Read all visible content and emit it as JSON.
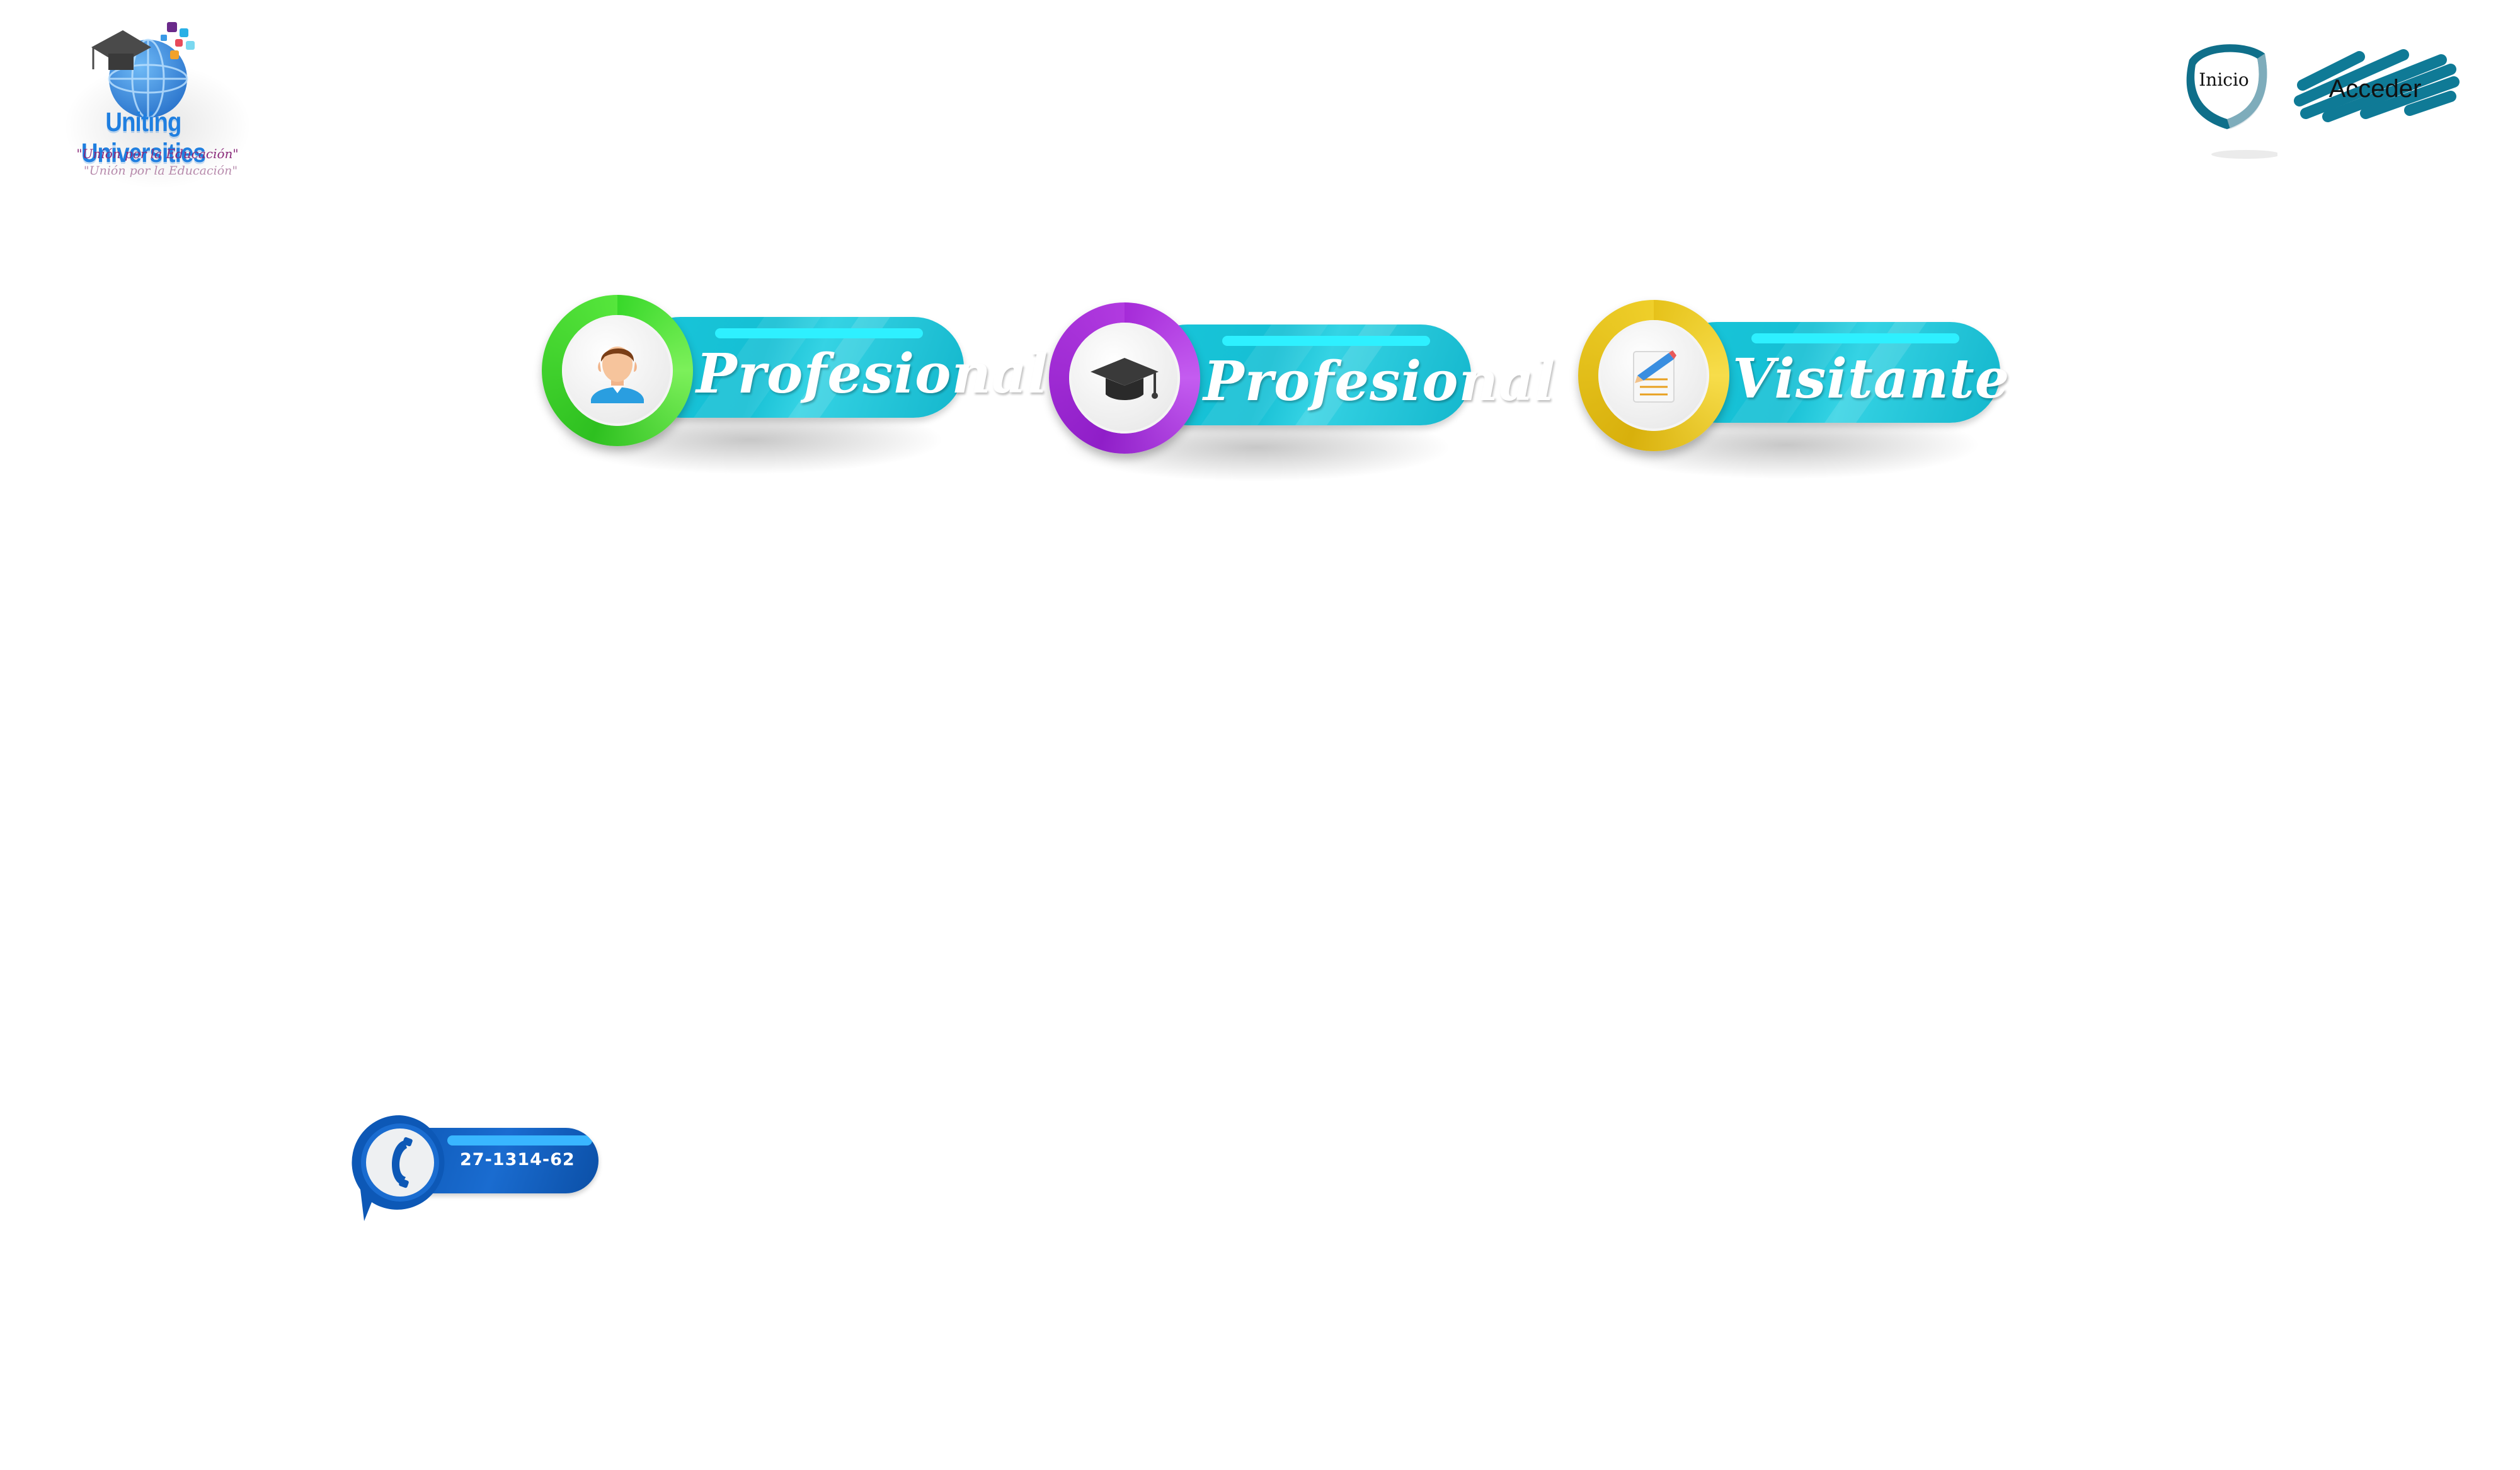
{
  "logo": {
    "title": "Uniting Universities",
    "slogan": "\"Unión por la Educación\"",
    "slogan_echo": "\"Unión por la Educación\""
  },
  "nav": {
    "inicio_label": "Inicio",
    "acceder_label": "Acceder"
  },
  "roles": [
    {
      "label": "Profesional",
      "icon": "user-avatar-icon",
      "ring_color": "#38d82a"
    },
    {
      "label": "Profesional",
      "icon": "graduation-cap-icon",
      "ring_color": "#a52bd8"
    },
    {
      "label": "Visitante",
      "icon": "notepad-pencil-icon",
      "ring_color": "#e6c21a"
    }
  ],
  "contact": {
    "phone": "27-1314-62",
    "icon": "phone-icon",
    "color": "#0d58b6"
  },
  "colors": {
    "accent": "#18c6da",
    "nav_accent": "#0f7a96"
  }
}
